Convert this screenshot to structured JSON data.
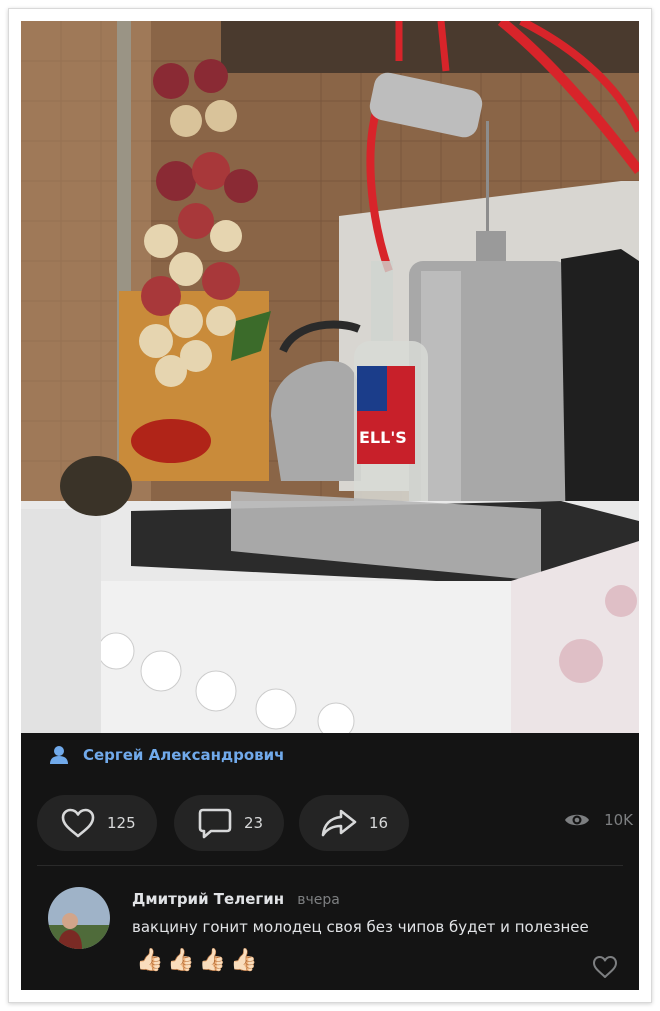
{
  "post": {
    "author": "Сергей Александрович",
    "photo_label": "ELL'S"
  },
  "actions": {
    "likes": "125",
    "comments": "23",
    "shares": "16",
    "views": "10K"
  },
  "comment": {
    "author": "Дмитрий Телегин",
    "date": "вчера",
    "text": "вакцину гонит молодец своя без чипов будет и полезнее",
    "emoji": "👍🏻👍🏻👍🏻👍🏻"
  },
  "colors": {
    "accent": "#71aaeb",
    "background": "#141414",
    "pill": "#242424"
  },
  "icons": {
    "author": "person-icon",
    "like": "heart-icon",
    "comment": "comment-icon",
    "share": "share-arrow-icon",
    "views": "eye-icon",
    "comment_like": "heart-outline-icon"
  }
}
